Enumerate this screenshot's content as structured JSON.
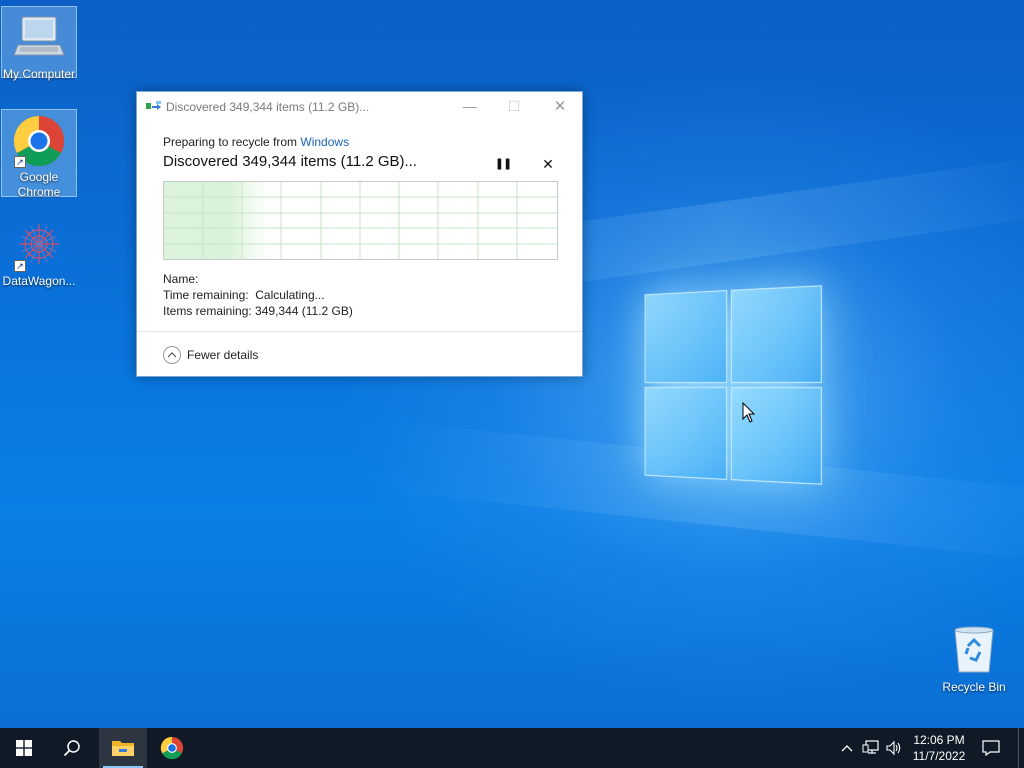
{
  "desktop": {
    "icons": [
      {
        "label": "My Computer"
      },
      {
        "label": "Google Chrome"
      },
      {
        "label": "DataWagon..."
      }
    ],
    "recycle_bin": {
      "label": "Recycle Bin"
    }
  },
  "dialog": {
    "title": "Discovered 349,344 items (11.2 GB)...",
    "preparing_prefix": "Preparing to recycle from ",
    "preparing_target": "Windows",
    "status": "Discovered 349,344 items (11.2 GB)...",
    "name_label": "Name:",
    "name_value": "",
    "time_label": "Time remaining:",
    "time_value": "Calculating...",
    "items_label": "Items remaining:",
    "items_value": "349,344 (11.2 GB)",
    "fewer_details_label": "Fewer details",
    "window_buttons": {
      "minimize": "—",
      "maximize": "☐",
      "close": "✕"
    },
    "pause_glyph": "❚❚",
    "cancel_glyph": "✕"
  },
  "taskbar": {
    "time": "12:06 PM",
    "date": "11/7/2022",
    "icons": [
      "windows-start-icon",
      "search-icon",
      "file-explorer-icon",
      "chrome-icon"
    ],
    "tray_icons": [
      "chevron-up-icon",
      "network-icon",
      "volume-icon",
      "notification-icon"
    ]
  },
  "colors": {
    "wallpaper": "#0a73dc",
    "dialog_link": "#1b64b8",
    "taskbar": "#0f1a26",
    "progress_fill": "#d8f2d8"
  }
}
